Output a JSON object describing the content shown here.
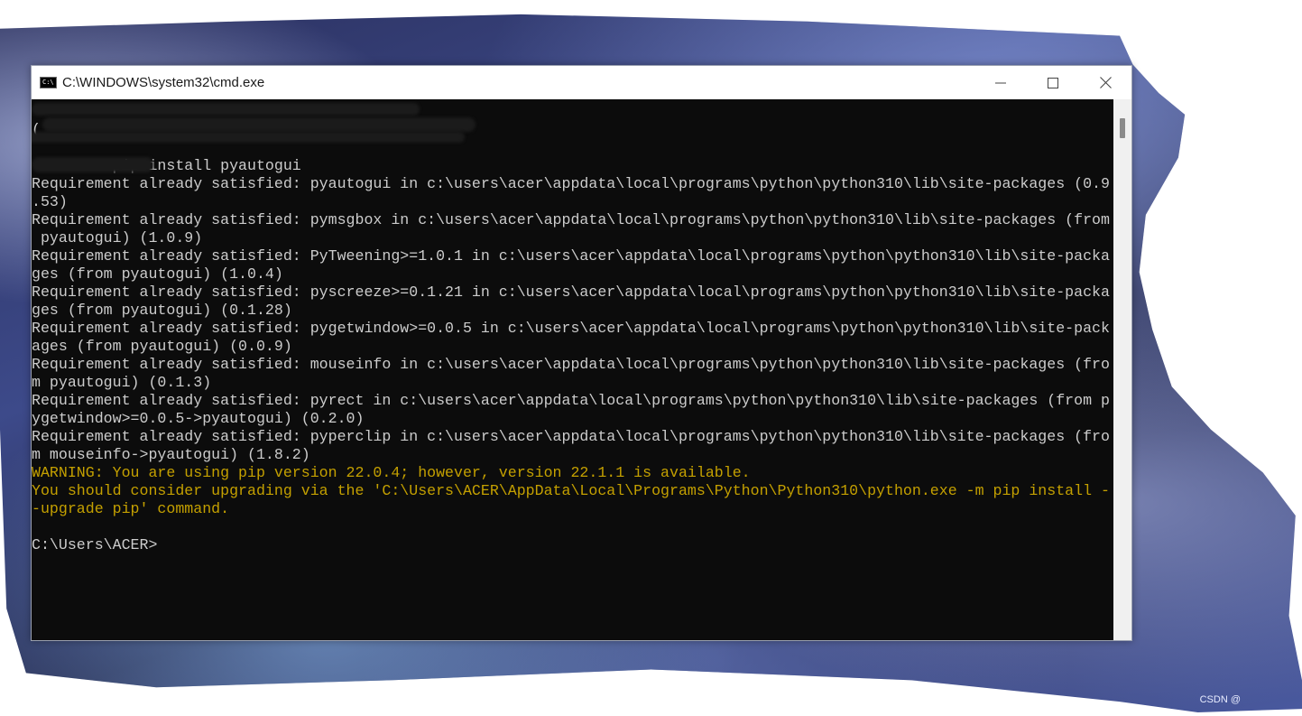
{
  "window": {
    "title": "C:\\WINDOWS\\system32\\cmd.exe",
    "icon": "cmd-icon",
    "icon_text": "C:\\"
  },
  "controls": {
    "minimize": "minimize-icon",
    "maximize": "maximize-icon",
    "close": "close-icon"
  },
  "console": {
    "lines": [
      {
        "text": "",
        "style": "normal"
      },
      {
        "text": "(",
        "style": "normal"
      },
      {
        "text": "",
        "style": "normal"
      },
      {
        "text": "         pip install pyautogui",
        "style": "normal"
      },
      {
        "text": "Requirement already satisfied: pyautogui in c:\\users\\acer\\appdata\\local\\programs\\python\\python310\\lib\\site-packages (0.9",
        "style": "normal"
      },
      {
        "text": ".53)",
        "style": "normal"
      },
      {
        "text": "Requirement already satisfied: pymsgbox in c:\\users\\acer\\appdata\\local\\programs\\python\\python310\\lib\\site-packages (from",
        "style": "normal"
      },
      {
        "text": " pyautogui) (1.0.9)",
        "style": "normal"
      },
      {
        "text": "Requirement already satisfied: PyTweening>=1.0.1 in c:\\users\\acer\\appdata\\local\\programs\\python\\python310\\lib\\site-packa",
        "style": "normal"
      },
      {
        "text": "ges (from pyautogui) (1.0.4)",
        "style": "normal"
      },
      {
        "text": "Requirement already satisfied: pyscreeze>=0.1.21 in c:\\users\\acer\\appdata\\local\\programs\\python\\python310\\lib\\site-packa",
        "style": "normal"
      },
      {
        "text": "ges (from pyautogui) (0.1.28)",
        "style": "normal"
      },
      {
        "text": "Requirement already satisfied: pygetwindow>=0.0.5 in c:\\users\\acer\\appdata\\local\\programs\\python\\python310\\lib\\site-pack",
        "style": "normal"
      },
      {
        "text": "ages (from pyautogui) (0.0.9)",
        "style": "normal"
      },
      {
        "text": "Requirement already satisfied: mouseinfo in c:\\users\\acer\\appdata\\local\\programs\\python\\python310\\lib\\site-packages (fro",
        "style": "normal"
      },
      {
        "text": "m pyautogui) (0.1.3)",
        "style": "normal"
      },
      {
        "text": "Requirement already satisfied: pyrect in c:\\users\\acer\\appdata\\local\\programs\\python\\python310\\lib\\site-packages (from p",
        "style": "normal"
      },
      {
        "text": "ygetwindow>=0.0.5->pyautogui) (0.2.0)",
        "style": "normal"
      },
      {
        "text": "Requirement already satisfied: pyperclip in c:\\users\\acer\\appdata\\local\\programs\\python\\python310\\lib\\site-packages (fro",
        "style": "normal"
      },
      {
        "text": "m mouseinfo->pyautogui) (1.8.2)",
        "style": "normal"
      },
      {
        "text": "WARNING: You are using pip version 22.0.4; however, version 22.1.1 is available.",
        "style": "warn"
      },
      {
        "text": "You should consider upgrading via the 'C:\\Users\\ACER\\AppData\\Local\\Programs\\Python\\Python310\\python.exe -m pip install -",
        "style": "warn"
      },
      {
        "text": "-upgrade pip' command.",
        "style": "warn"
      },
      {
        "text": "",
        "style": "normal"
      },
      {
        "text": "C:\\Users\\ACER>",
        "style": "normal"
      }
    ]
  },
  "watermark": {
    "text": "CSDN @"
  }
}
